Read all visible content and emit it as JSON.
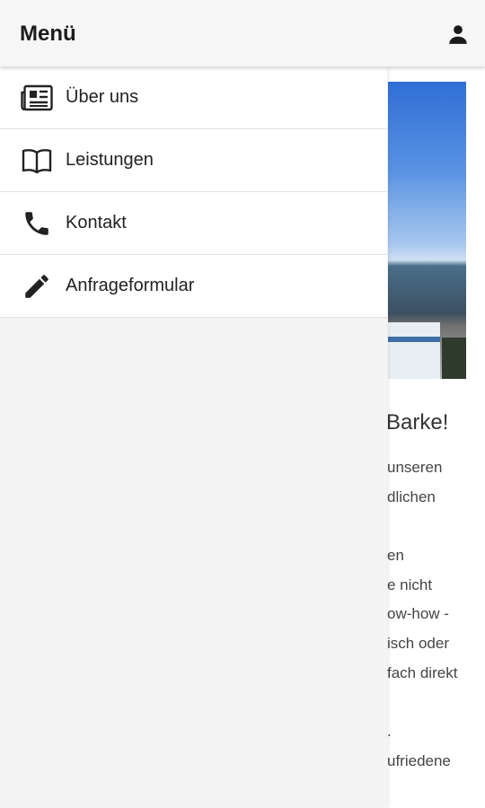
{
  "header": {
    "title": "Menü",
    "user_icon": "person-icon"
  },
  "drawer": {
    "items": [
      {
        "label": "Über uns",
        "icon": "newspaper-icon"
      },
      {
        "label": "Leistungen",
        "icon": "book-icon"
      },
      {
        "label": "Kontakt",
        "icon": "phone-icon"
      },
      {
        "label": "Anfrageformular",
        "icon": "pencil-icon"
      }
    ]
  },
  "background": {
    "headline": "Barke!",
    "text_lines": [
      "unseren",
      "dlichen",
      "",
      "en",
      "e nicht",
      "ow-how -",
      "isch oder",
      "fach direkt",
      "",
      ".",
      "ufriedene"
    ]
  }
}
